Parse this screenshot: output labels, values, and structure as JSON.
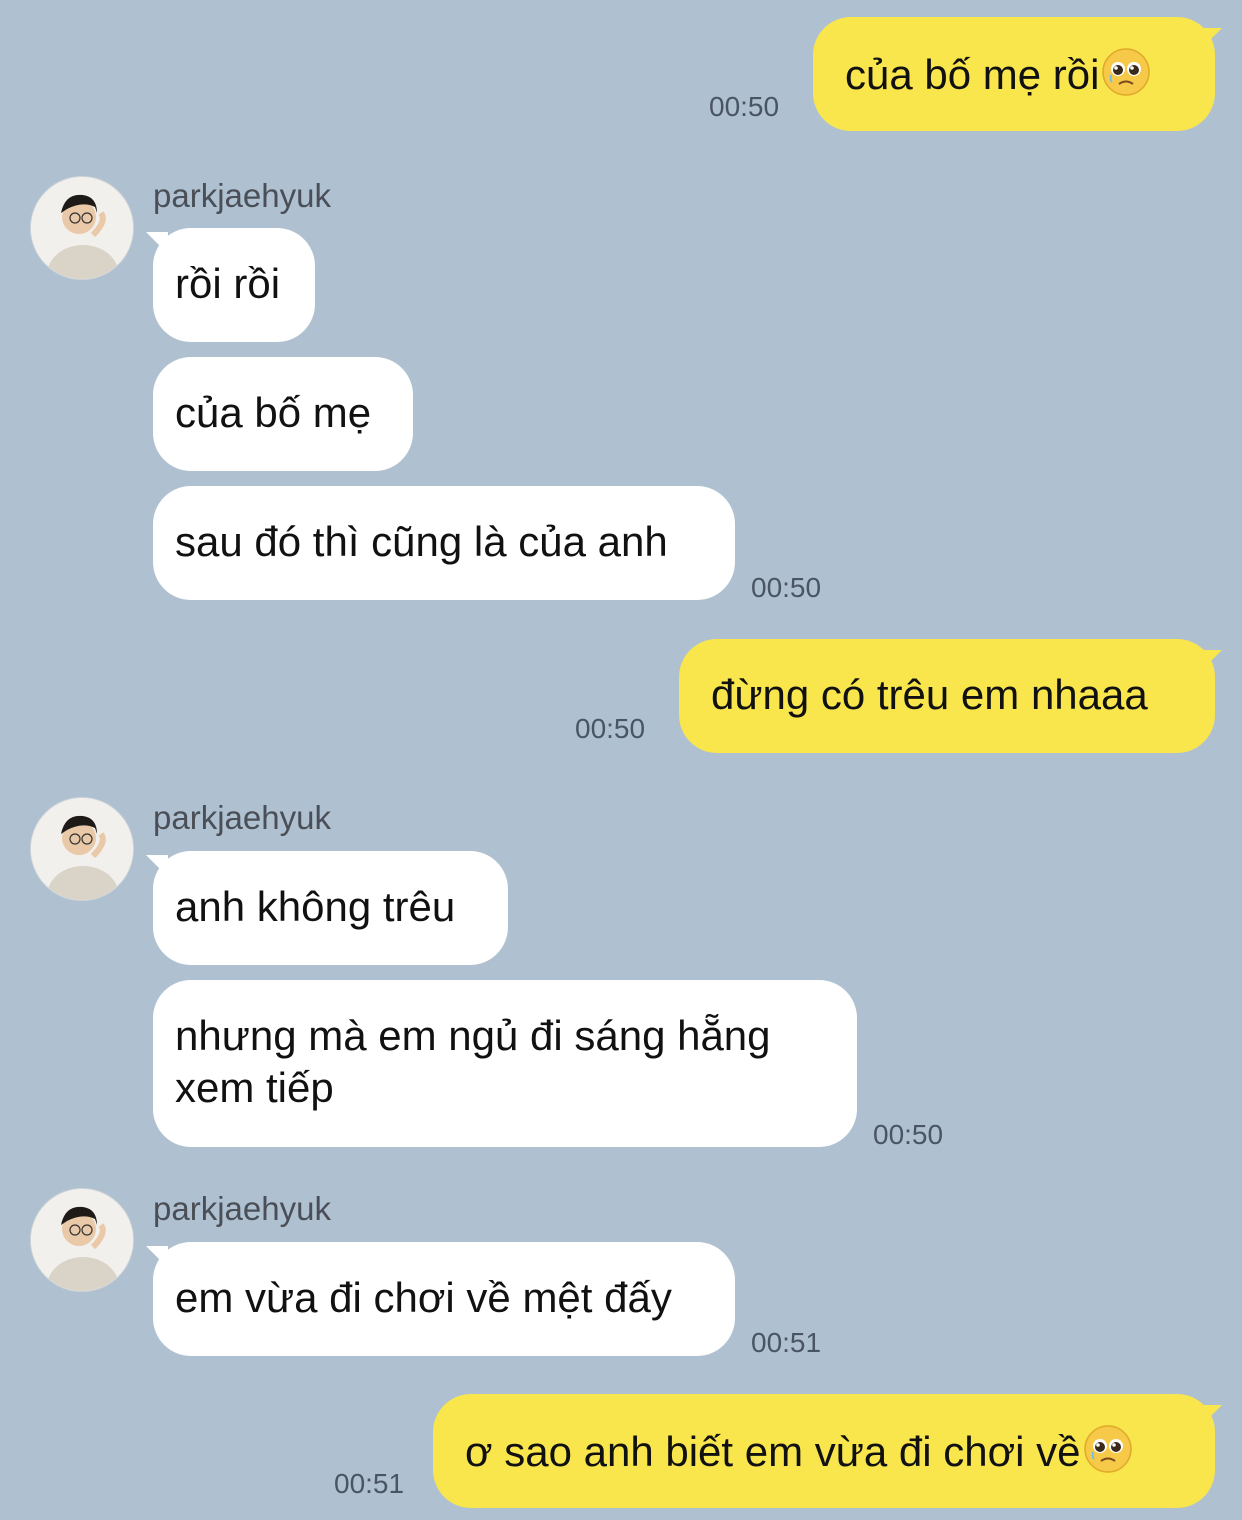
{
  "contact_name": "parkjaehyuk",
  "avatar_icon": "profile-photo-icon",
  "emoji_icon": "pleading-face-emoji",
  "colors": {
    "background": "#afc1d1",
    "my_bubble": "#f9e64c",
    "their_bubble": "#ffffff",
    "timestamp": "#4a5563"
  },
  "messages": [
    {
      "from": "me",
      "text": "của bố mẹ rồi",
      "emoji": true,
      "time": "00:50"
    },
    {
      "from": "them",
      "sender": "parkjaehyuk",
      "text": "rồi rồi"
    },
    {
      "from": "them",
      "text": "của bố mẹ"
    },
    {
      "from": "them",
      "text": "sau đó thì cũng là của anh",
      "time": "00:50"
    },
    {
      "from": "me",
      "text": "đừng có trêu em nhaaa",
      "time": "00:50"
    },
    {
      "from": "them",
      "sender": "parkjaehyuk",
      "text": "anh không trêu"
    },
    {
      "from": "them",
      "text_line1": "nhưng mà em ngủ đi sáng hẵng",
      "text_line2": "xem tiếp",
      "time": "00:50"
    },
    {
      "from": "them",
      "sender": "parkjaehyuk",
      "text": "em vừa đi chơi về mệt đấy",
      "time": "00:51"
    },
    {
      "from": "me",
      "text": "ơ sao anh biết em vừa đi chơi về",
      "emoji": true,
      "time": "00:51"
    }
  ]
}
